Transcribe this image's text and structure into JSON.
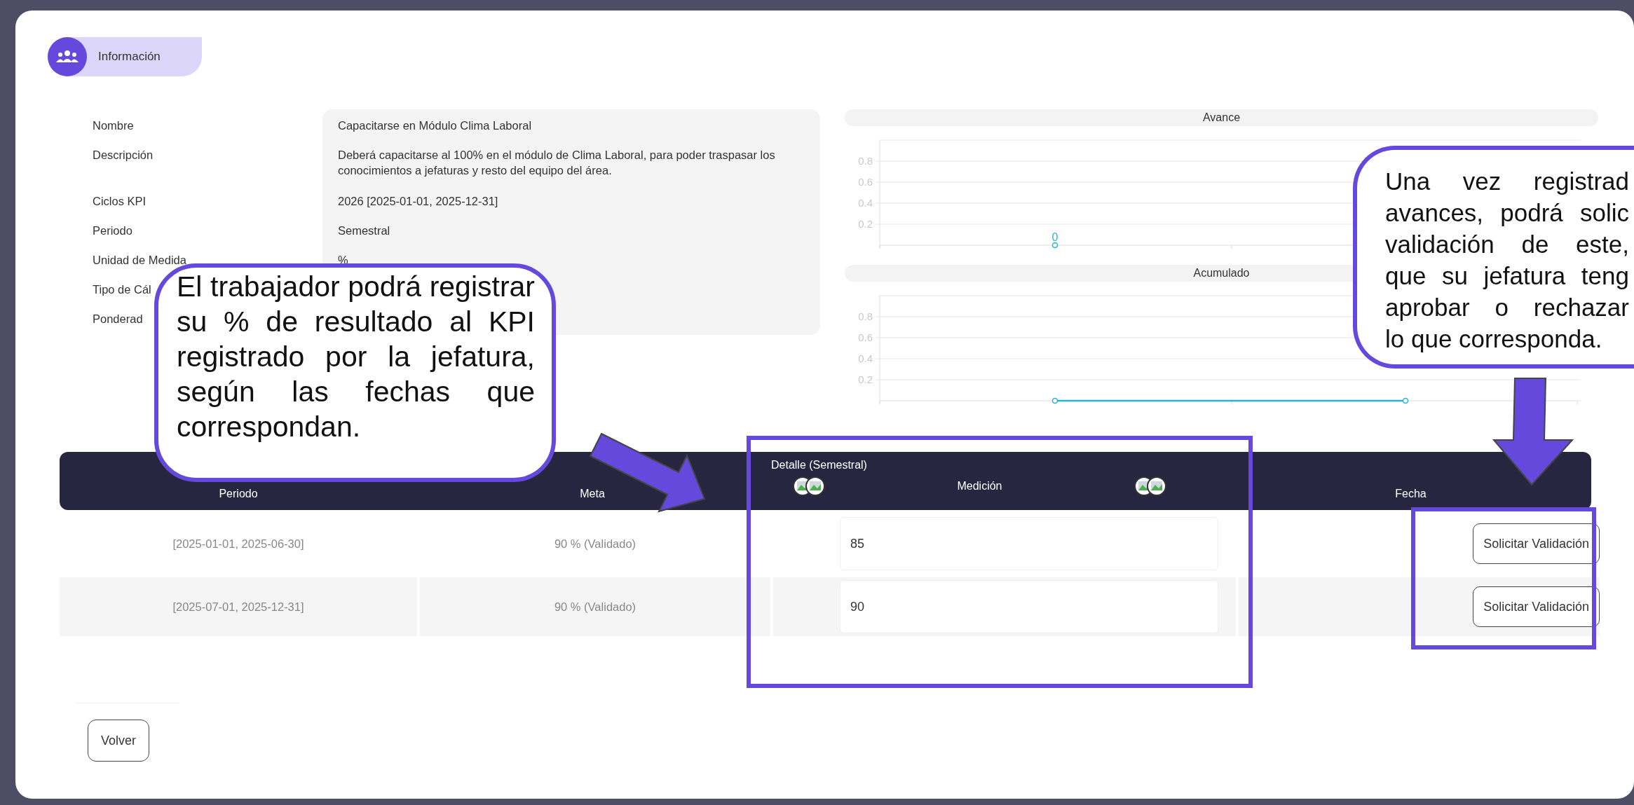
{
  "section_tag": {
    "label": "Información"
  },
  "info": [
    {
      "label": "Nombre",
      "value": "Capacitarse en Módulo Clima Laboral"
    },
    {
      "label": "Descripción",
      "value": "Deberá capacitarse al 100% en el módulo de Clima Laboral, para poder traspasar los conocimientos a jefaturas y resto del equipo del área."
    },
    {
      "label": "Ciclos KPI",
      "value": "2026 [2025-01-01, 2025-12-31]"
    },
    {
      "label": "Periodo",
      "value": "Semestral"
    },
    {
      "label": "Unidad de Medida",
      "value": "%"
    },
    {
      "label": "Tipo de Cál"
    },
    {
      "label": "Ponderad"
    }
  ],
  "charts": [
    {
      "title": "Avance",
      "chart_data": {
        "type": "scatter",
        "values": [
          0
        ],
        "yticks": [
          0.2,
          0.4,
          0.6,
          0.8
        ],
        "ylim": [
          0,
          1
        ],
        "grid": true,
        "data_labels": true
      }
    },
    {
      "title": "Acumulado",
      "chart_data": {
        "type": "line",
        "values": [
          0,
          0
        ],
        "yticks": [
          0.2,
          0.4,
          0.6,
          0.8
        ],
        "ylim": [
          0,
          1
        ],
        "grid": true,
        "marker": true
      }
    }
  ],
  "table": {
    "group_header": "Detalle (Semestral)",
    "columns": [
      "Periodo",
      "Meta",
      "Medición",
      "Fecha"
    ],
    "rows": [
      {
        "periodo": "[2025-01-01, 2025-06-30]",
        "meta": "90 % (Validado)",
        "medicion": "85",
        "action": "Solicitar Validación"
      },
      {
        "periodo": "[2025-07-01, 2025-12-31]",
        "meta": "90 % (Validado)",
        "medicion": "90",
        "action": "Solicitar Validación"
      }
    ]
  },
  "back_button": "Volver",
  "callouts": [
    {
      "text": "El trabajador podrá registrar su % de resultado al KPI registrado por la jefatura, según las fechas que correspondan."
    },
    {
      "lines": [
        "Una vez registrad",
        "avances, podrá solic",
        "validación de este,",
        "que su jefatura teng",
        "aprobar o rechazar",
        "lo que corresponda."
      ]
    }
  ]
}
